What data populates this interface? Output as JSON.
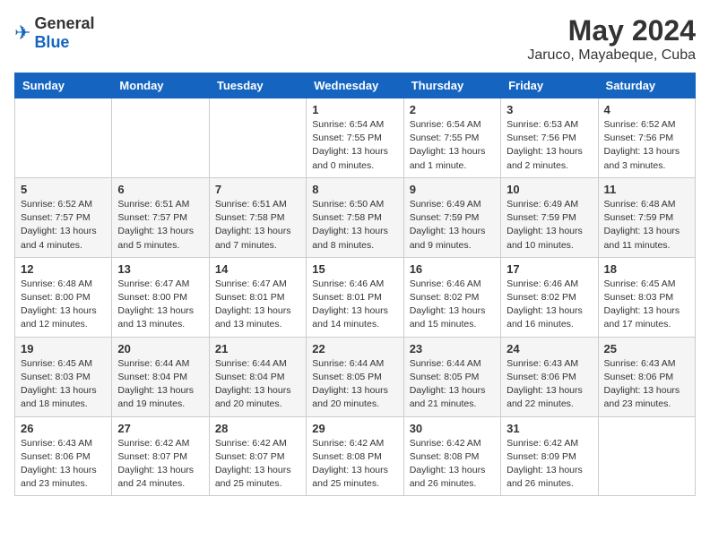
{
  "logo": {
    "general": "General",
    "blue": "Blue"
  },
  "title": "May 2024",
  "location": "Jaruco, Mayabeque, Cuba",
  "weekdays": [
    "Sunday",
    "Monday",
    "Tuesday",
    "Wednesday",
    "Thursday",
    "Friday",
    "Saturday"
  ],
  "weeks": [
    [
      {
        "day": "",
        "sunrise": "",
        "sunset": "",
        "daylight": ""
      },
      {
        "day": "",
        "sunrise": "",
        "sunset": "",
        "daylight": ""
      },
      {
        "day": "",
        "sunrise": "",
        "sunset": "",
        "daylight": ""
      },
      {
        "day": "1",
        "sunrise": "Sunrise: 6:54 AM",
        "sunset": "Sunset: 7:55 PM",
        "daylight": "Daylight: 13 hours and 0 minutes."
      },
      {
        "day": "2",
        "sunrise": "Sunrise: 6:54 AM",
        "sunset": "Sunset: 7:55 PM",
        "daylight": "Daylight: 13 hours and 1 minute."
      },
      {
        "day": "3",
        "sunrise": "Sunrise: 6:53 AM",
        "sunset": "Sunset: 7:56 PM",
        "daylight": "Daylight: 13 hours and 2 minutes."
      },
      {
        "day": "4",
        "sunrise": "Sunrise: 6:52 AM",
        "sunset": "Sunset: 7:56 PM",
        "daylight": "Daylight: 13 hours and 3 minutes."
      }
    ],
    [
      {
        "day": "5",
        "sunrise": "Sunrise: 6:52 AM",
        "sunset": "Sunset: 7:57 PM",
        "daylight": "Daylight: 13 hours and 4 minutes."
      },
      {
        "day": "6",
        "sunrise": "Sunrise: 6:51 AM",
        "sunset": "Sunset: 7:57 PM",
        "daylight": "Daylight: 13 hours and 5 minutes."
      },
      {
        "day": "7",
        "sunrise": "Sunrise: 6:51 AM",
        "sunset": "Sunset: 7:58 PM",
        "daylight": "Daylight: 13 hours and 7 minutes."
      },
      {
        "day": "8",
        "sunrise": "Sunrise: 6:50 AM",
        "sunset": "Sunset: 7:58 PM",
        "daylight": "Daylight: 13 hours and 8 minutes."
      },
      {
        "day": "9",
        "sunrise": "Sunrise: 6:49 AM",
        "sunset": "Sunset: 7:59 PM",
        "daylight": "Daylight: 13 hours and 9 minutes."
      },
      {
        "day": "10",
        "sunrise": "Sunrise: 6:49 AM",
        "sunset": "Sunset: 7:59 PM",
        "daylight": "Daylight: 13 hours and 10 minutes."
      },
      {
        "day": "11",
        "sunrise": "Sunrise: 6:48 AM",
        "sunset": "Sunset: 7:59 PM",
        "daylight": "Daylight: 13 hours and 11 minutes."
      }
    ],
    [
      {
        "day": "12",
        "sunrise": "Sunrise: 6:48 AM",
        "sunset": "Sunset: 8:00 PM",
        "daylight": "Daylight: 13 hours and 12 minutes."
      },
      {
        "day": "13",
        "sunrise": "Sunrise: 6:47 AM",
        "sunset": "Sunset: 8:00 PM",
        "daylight": "Daylight: 13 hours and 13 minutes."
      },
      {
        "day": "14",
        "sunrise": "Sunrise: 6:47 AM",
        "sunset": "Sunset: 8:01 PM",
        "daylight": "Daylight: 13 hours and 13 minutes."
      },
      {
        "day": "15",
        "sunrise": "Sunrise: 6:46 AM",
        "sunset": "Sunset: 8:01 PM",
        "daylight": "Daylight: 13 hours and 14 minutes."
      },
      {
        "day": "16",
        "sunrise": "Sunrise: 6:46 AM",
        "sunset": "Sunset: 8:02 PM",
        "daylight": "Daylight: 13 hours and 15 minutes."
      },
      {
        "day": "17",
        "sunrise": "Sunrise: 6:46 AM",
        "sunset": "Sunset: 8:02 PM",
        "daylight": "Daylight: 13 hours and 16 minutes."
      },
      {
        "day": "18",
        "sunrise": "Sunrise: 6:45 AM",
        "sunset": "Sunset: 8:03 PM",
        "daylight": "Daylight: 13 hours and 17 minutes."
      }
    ],
    [
      {
        "day": "19",
        "sunrise": "Sunrise: 6:45 AM",
        "sunset": "Sunset: 8:03 PM",
        "daylight": "Daylight: 13 hours and 18 minutes."
      },
      {
        "day": "20",
        "sunrise": "Sunrise: 6:44 AM",
        "sunset": "Sunset: 8:04 PM",
        "daylight": "Daylight: 13 hours and 19 minutes."
      },
      {
        "day": "21",
        "sunrise": "Sunrise: 6:44 AM",
        "sunset": "Sunset: 8:04 PM",
        "daylight": "Daylight: 13 hours and 20 minutes."
      },
      {
        "day": "22",
        "sunrise": "Sunrise: 6:44 AM",
        "sunset": "Sunset: 8:05 PM",
        "daylight": "Daylight: 13 hours and 20 minutes."
      },
      {
        "day": "23",
        "sunrise": "Sunrise: 6:44 AM",
        "sunset": "Sunset: 8:05 PM",
        "daylight": "Daylight: 13 hours and 21 minutes."
      },
      {
        "day": "24",
        "sunrise": "Sunrise: 6:43 AM",
        "sunset": "Sunset: 8:06 PM",
        "daylight": "Daylight: 13 hours and 22 minutes."
      },
      {
        "day": "25",
        "sunrise": "Sunrise: 6:43 AM",
        "sunset": "Sunset: 8:06 PM",
        "daylight": "Daylight: 13 hours and 23 minutes."
      }
    ],
    [
      {
        "day": "26",
        "sunrise": "Sunrise: 6:43 AM",
        "sunset": "Sunset: 8:06 PM",
        "daylight": "Daylight: 13 hours and 23 minutes."
      },
      {
        "day": "27",
        "sunrise": "Sunrise: 6:42 AM",
        "sunset": "Sunset: 8:07 PM",
        "daylight": "Daylight: 13 hours and 24 minutes."
      },
      {
        "day": "28",
        "sunrise": "Sunrise: 6:42 AM",
        "sunset": "Sunset: 8:07 PM",
        "daylight": "Daylight: 13 hours and 25 minutes."
      },
      {
        "day": "29",
        "sunrise": "Sunrise: 6:42 AM",
        "sunset": "Sunset: 8:08 PM",
        "daylight": "Daylight: 13 hours and 25 minutes."
      },
      {
        "day": "30",
        "sunrise": "Sunrise: 6:42 AM",
        "sunset": "Sunset: 8:08 PM",
        "daylight": "Daylight: 13 hours and 26 minutes."
      },
      {
        "day": "31",
        "sunrise": "Sunrise: 6:42 AM",
        "sunset": "Sunset: 8:09 PM",
        "daylight": "Daylight: 13 hours and 26 minutes."
      },
      {
        "day": "",
        "sunrise": "",
        "sunset": "",
        "daylight": ""
      }
    ]
  ]
}
